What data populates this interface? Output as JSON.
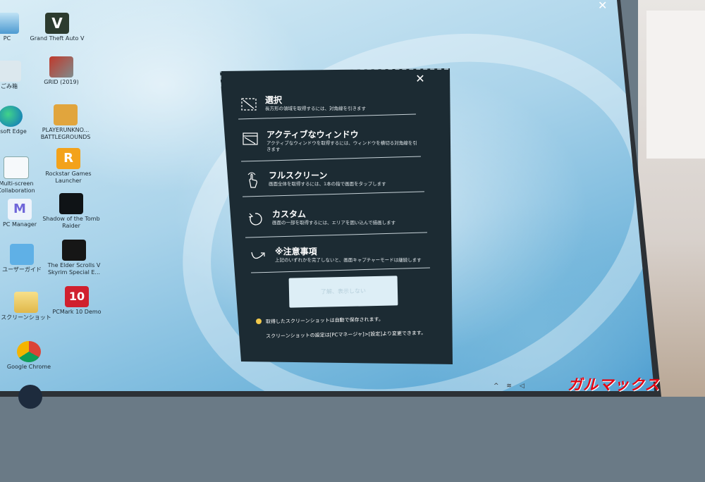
{
  "desktop": {
    "icons": [
      {
        "label": "PC",
        "icon": "pc-icon"
      },
      {
        "label": "Grand Theft Auto V",
        "icon": "gta-icon"
      },
      {
        "label": "ごみ箱",
        "icon": "recycle-bin-icon"
      },
      {
        "label": "GRID (2019)",
        "icon": "grid-icon"
      },
      {
        "label": "rosoft Edge",
        "icon": "edge-icon"
      },
      {
        "label": "PLAYERUNKNO... BATTLEGROUNDS",
        "icon": "pubg-icon"
      },
      {
        "label": "Multi-screen Collaboration",
        "icon": "multiscreen-icon"
      },
      {
        "label": "Rockstar Games Launcher",
        "icon": "rockstar-icon"
      },
      {
        "label": "PC Manager",
        "icon": "pc-manager-icon"
      },
      {
        "label": "Shadow of the Tomb Raider",
        "icon": "tomb-raider-icon"
      },
      {
        "label": "ユーザーガイド",
        "icon": "user-guide-icon"
      },
      {
        "label": "The Elder Scrolls V Skyrim Special E...",
        "icon": "skyrim-icon"
      },
      {
        "label": "スクリーンショット",
        "icon": "screenshot-folder-icon"
      },
      {
        "label": "PCMark 10 Demo",
        "icon": "pcmark-icon"
      },
      {
        "label": "Google Chrome",
        "icon": "chrome-icon"
      }
    ]
  },
  "screenshot_panel": {
    "close_label": "✕",
    "modes": [
      {
        "title": "選択",
        "desc": "長方形の領域を取得するには、対角線を引きます",
        "icon": "select-region-icon"
      },
      {
        "title": "アクティブなウィンドウ",
        "desc": "アクティブなウィンドウを取得するには、ウィンドウを横切る対角線を引きます",
        "icon": "active-window-icon"
      },
      {
        "title": "フルスクリーン",
        "desc": "画面全体を取得するには、1本の指で画面をタップします",
        "icon": "tap-hand-icon"
      },
      {
        "title": "カスタム",
        "desc": "画面の一部を取得するには、エリアを囲い込んで描画します",
        "icon": "custom-lasso-icon"
      },
      {
        "title": "※注意事項",
        "desc": "上記のいずれかを完了しないと、画面キャプチャーモードは継続します",
        "icon": "curve-arrow-icon"
      }
    ],
    "primary_button": "了解、表示しない",
    "note_line1": "取得したスクリーンショットは自動で保存されます。",
    "note_line2": "スクリーンショットの設定は[PCマネージャ]>[設定]より変更できます。"
  },
  "top_close": "✕",
  "watermark": "ガルマックス"
}
